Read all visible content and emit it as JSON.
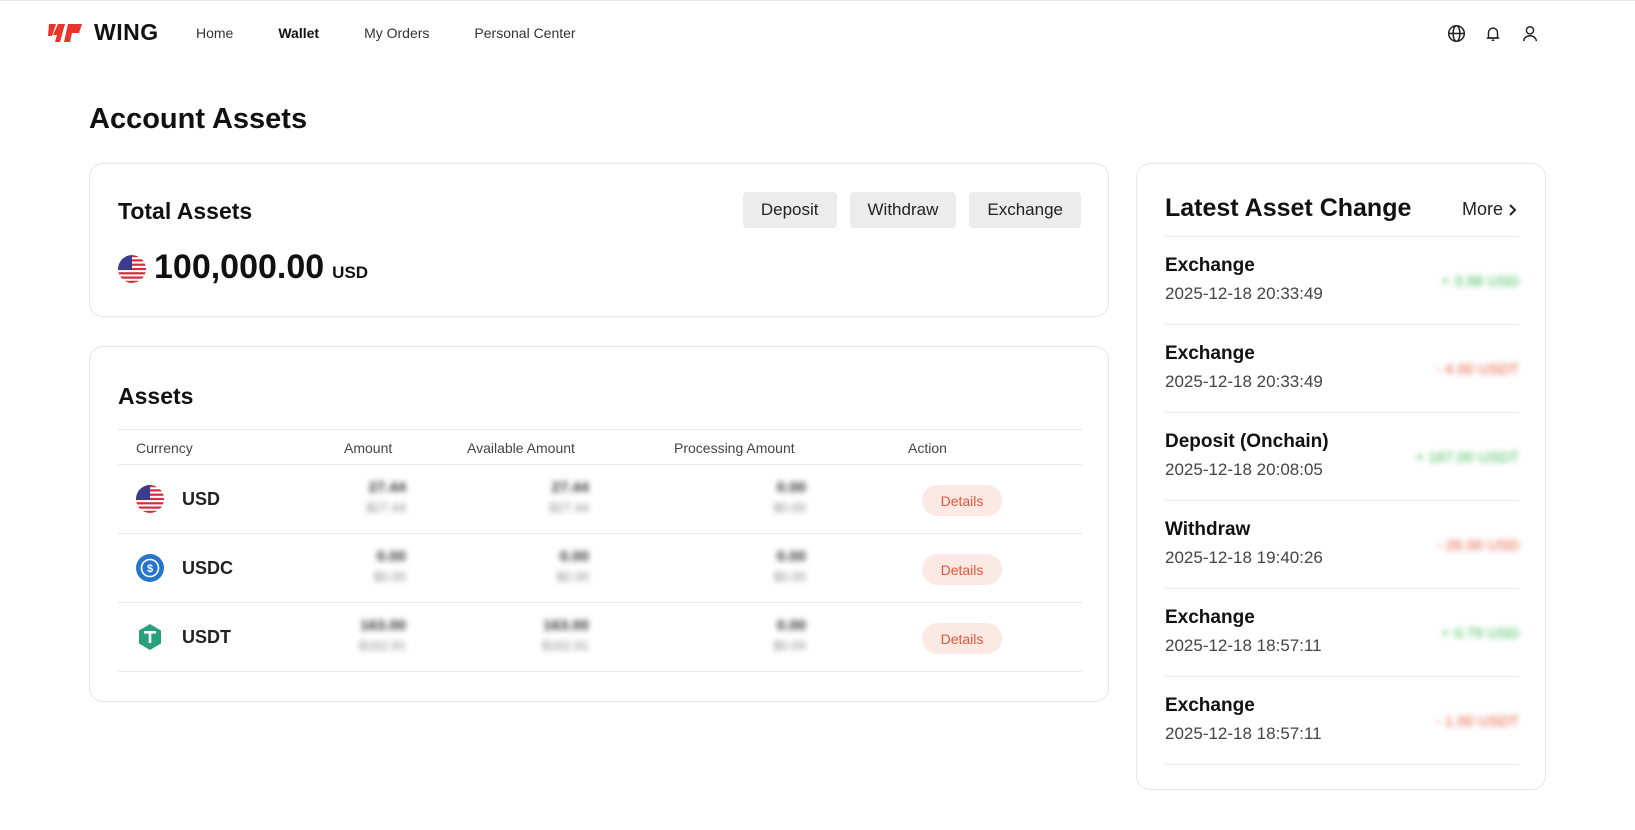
{
  "brand": {
    "name": "WING",
    "accent": "#e8352c"
  },
  "nav": {
    "links": [
      "Home",
      "Wallet",
      "My Orders",
      "Personal Center"
    ],
    "active": "Wallet",
    "icons": [
      "globe-icon",
      "bell-icon",
      "user-icon"
    ]
  },
  "page_title": "Account Assets",
  "total_assets": {
    "title": "Total Assets",
    "value": "100,000.00",
    "unit": "USD",
    "actions": [
      "Deposit",
      "Withdraw",
      "Exchange"
    ]
  },
  "assets": {
    "title": "Assets",
    "columns": [
      "Currency",
      "Amount",
      "Available Amount",
      "Processing Amount",
      "Action"
    ],
    "rows": [
      {
        "currency": "USD",
        "amount": "27.44",
        "amount_usd": "$27.44",
        "available": "27.44",
        "available_usd": "$27.44",
        "processing": "0.00",
        "processing_usd": "$0.00",
        "action": "Details"
      },
      {
        "currency": "USDC",
        "amount": "0.00",
        "amount_usd": "$0.00",
        "available": "0.00",
        "available_usd": "$0.00",
        "processing": "0.00",
        "processing_usd": "$0.00",
        "action": "Details"
      },
      {
        "currency": "USDT",
        "amount": "163.00",
        "amount_usd": "$162.91",
        "available": "163.00",
        "available_usd": "$162.91",
        "processing": "0.00",
        "processing_usd": "$0.00",
        "action": "Details"
      }
    ]
  },
  "latest": {
    "title": "Latest Asset Change",
    "more_label": "More",
    "items": [
      {
        "type": "Exchange",
        "time": "2025-12-18 20:33:49",
        "amount": "+ 3.98 USD",
        "sign": "pos"
      },
      {
        "type": "Exchange",
        "time": "2025-12-18 20:33:49",
        "amount": "- 4.00 USDT",
        "sign": "neg"
      },
      {
        "type": "Deposit (Onchain)",
        "time": "2025-12-18 20:08:05",
        "amount": "+ 167.00 USDT",
        "sign": "pos"
      },
      {
        "type": "Withdraw",
        "time": "2025-12-18 19:40:26",
        "amount": "- 26.00 USD",
        "sign": "neg"
      },
      {
        "type": "Exchange",
        "time": "2025-12-18 18:57:11",
        "amount": "+ 0.79 USD",
        "sign": "pos"
      },
      {
        "type": "Exchange",
        "time": "2025-12-18 18:57:11",
        "amount": "- 1.00 USDT",
        "sign": "neg"
      }
    ]
  }
}
